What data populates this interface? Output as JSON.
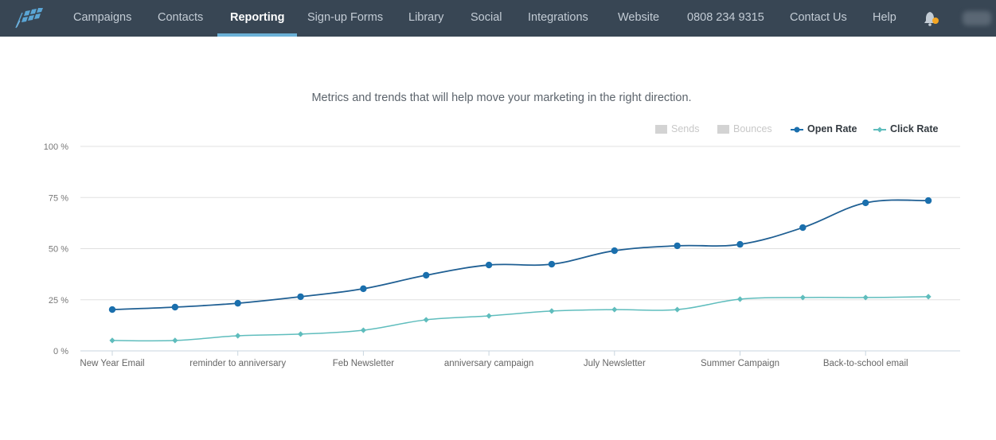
{
  "nav": {
    "items": [
      {
        "label": "Campaigns",
        "active": false
      },
      {
        "label": "Contacts",
        "active": false
      },
      {
        "label": "Reporting",
        "active": true
      },
      {
        "label": "Sign-up Forms",
        "active": false
      },
      {
        "label": "Library",
        "active": false
      },
      {
        "label": "Social",
        "active": false
      },
      {
        "label": "Integrations",
        "active": false
      },
      {
        "label": "Website",
        "active": false
      },
      {
        "label": "0808 234 9315",
        "active": false
      },
      {
        "label": "Contact Us",
        "active": false
      },
      {
        "label": "Help",
        "active": false
      }
    ],
    "logo_icon": "flag-logo-icon",
    "bell_icon": "bell-icon",
    "notification_dot_color": "#f5a623"
  },
  "page": {
    "subtitle": "Metrics and trends that will help move your marketing in the right direction."
  },
  "legend": [
    {
      "label": "Sends",
      "enabled": false,
      "marker": "square"
    },
    {
      "label": "Bounces",
      "enabled": false,
      "marker": "square"
    },
    {
      "label": "Open Rate",
      "enabled": true,
      "marker": "circle",
      "color": "#1a6fad"
    },
    {
      "label": "Click Rate",
      "enabled": true,
      "marker": "diamond",
      "color": "#5fbdbd"
    }
  ],
  "chart_data": {
    "type": "line",
    "title": "",
    "xlabel": "",
    "ylabel": "",
    "ylim": [
      0,
      100
    ],
    "y_ticks": [
      "0 %",
      "25 %",
      "50 %",
      "75 %",
      "100 %"
    ],
    "y_tick_values": [
      0,
      25,
      50,
      75,
      100
    ],
    "categories_count": 14,
    "x_tick_labels": [
      {
        "index": 0,
        "label": "New Year Email"
      },
      {
        "index": 2,
        "label": "reminder to anniversary"
      },
      {
        "index": 4,
        "label": "Feb Newsletter"
      },
      {
        "index": 6,
        "label": "anniversary campaign"
      },
      {
        "index": 8,
        "label": "July Newsletter"
      },
      {
        "index": 10,
        "label": "Summer Campaign"
      },
      {
        "index": 12,
        "label": "Back-to-school email"
      }
    ],
    "grid": true,
    "legend_position": "top-right",
    "series": [
      {
        "name": "Open Rate",
        "color": "#1a6fad",
        "marker": "circle",
        "values": [
          20.2,
          21.4,
          23.3,
          26.5,
          30.4,
          37.0,
          42.0,
          42.4,
          49.0,
          51.4,
          52.1,
          60.3,
          72.4,
          73.5
        ]
      },
      {
        "name": "Click Rate",
        "color": "#5fbdbd",
        "marker": "diamond",
        "values": [
          5.1,
          5.1,
          7.4,
          8.2,
          10.1,
          15.2,
          17.1,
          19.5,
          20.2,
          20.2,
          25.3,
          26.1,
          26.1,
          26.5
        ]
      },
      {
        "name": "Sends",
        "enabled": false,
        "values": []
      },
      {
        "name": "Bounces",
        "enabled": false,
        "values": []
      }
    ]
  }
}
